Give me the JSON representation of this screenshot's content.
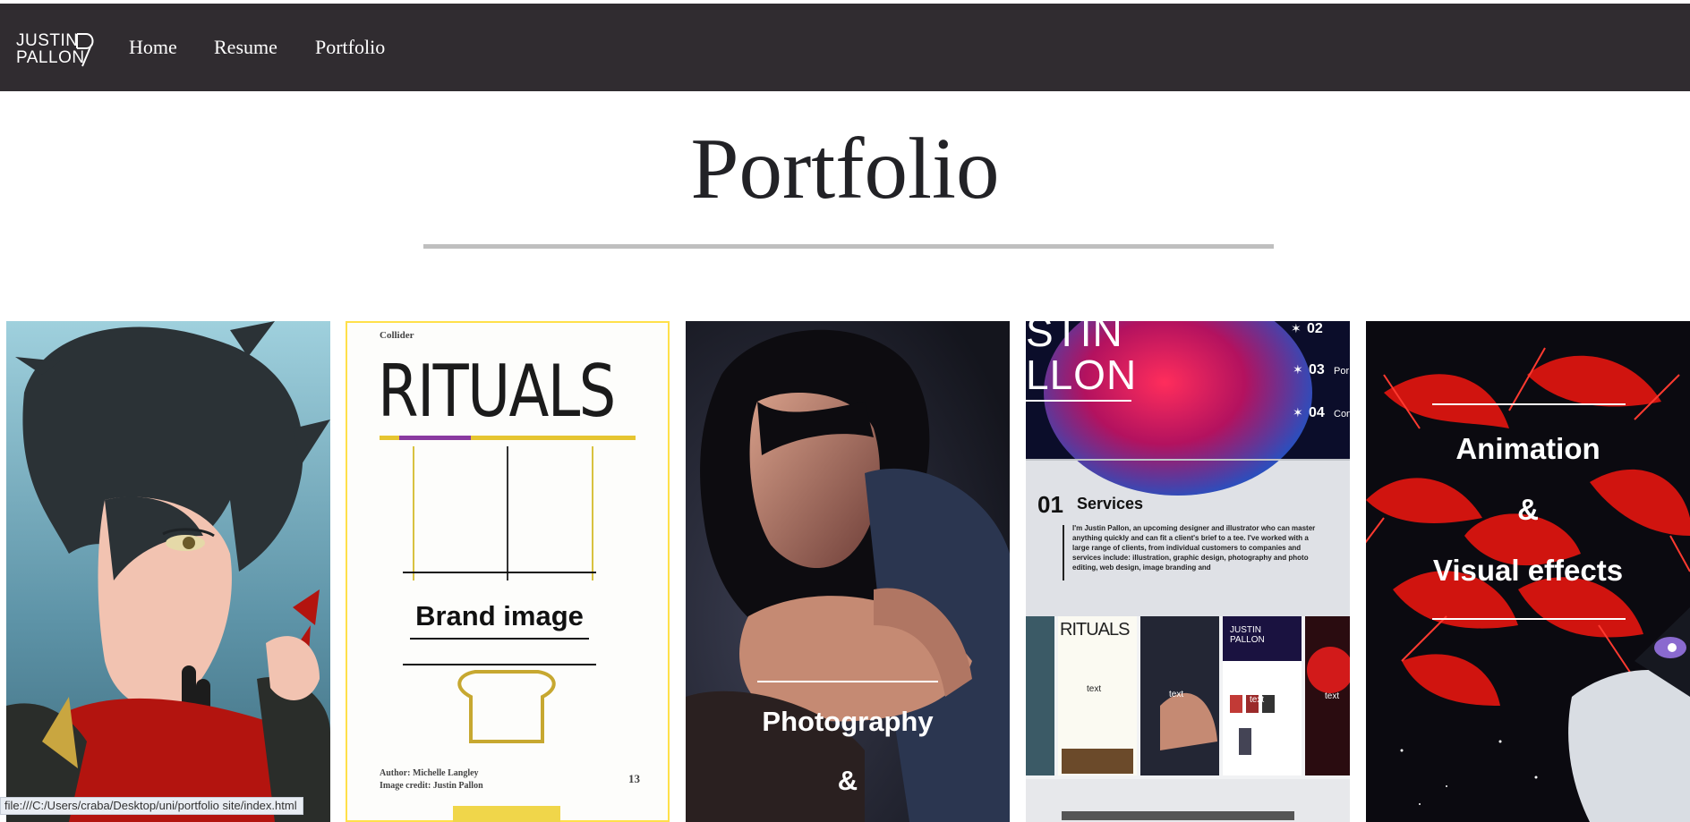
{
  "nav": {
    "logo_line1": "JUSTIN",
    "logo_line2": "PALLON",
    "links": [
      "Home",
      "Resume",
      "Portfolio"
    ]
  },
  "page": {
    "title": "Portfolio"
  },
  "gallery": {
    "tiles": [
      {
        "caption": ""
      },
      {
        "caption": "Brand image",
        "magazine_label": "Collider",
        "magazine_title": "RITUALS",
        "author": "Author: Michelle Langley",
        "credit": "Image credit: Justin Pallon",
        "page_number": "13"
      },
      {
        "caption_line1": "Photography",
        "caption_line2": "&"
      },
      {
        "logo_line1": "STIN",
        "logo_line2": "LLON",
        "menu": [
          {
            "num": "02",
            "label": ""
          },
          {
            "num": "03",
            "label": "Por"
          },
          {
            "num": "04",
            "label": "Conta"
          }
        ],
        "section_num": "01",
        "section_title": "Services",
        "body": "I'm Justin Pallon, an upcoming designer and illustrator who can master anything quickly and can fit a client's brief to a tee. I've worked with a large range of clients, from individual customers to companies and services include: illustration, graphic design, photography and photo editing, web design, image branding and",
        "thumb_title": "RITUALS",
        "thumb_text": "text",
        "thumb_logo": "JUSTIN PALLON"
      },
      {
        "caption_line1": "Animation",
        "caption_line2": "&",
        "caption_line3": "Visual effects"
      }
    ]
  },
  "status": {
    "url": "file:///C:/Users/craba/Desktop/uni/portfolio site/index.html"
  },
  "colors": {
    "nav_bg": "#302c30",
    "title": "#222226",
    "rule": "#bfbfbf"
  }
}
